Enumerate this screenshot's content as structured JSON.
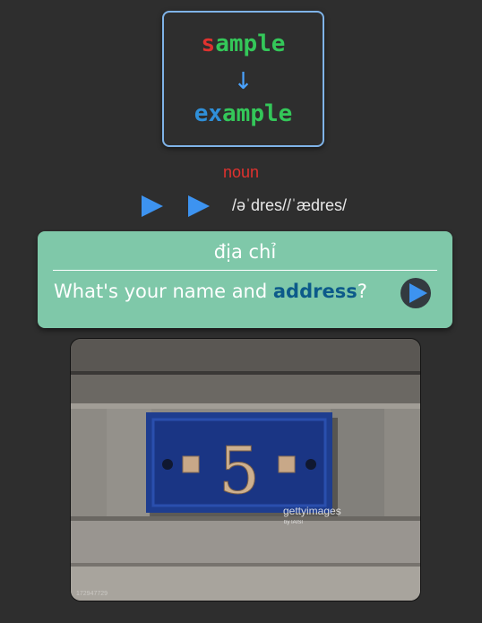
{
  "word_box": {
    "sample_first": "s",
    "sample_rest": "ample",
    "arrow": "↓",
    "example_first": "ex",
    "example_rest": "ample"
  },
  "part_of_speech": "noun",
  "pronunciation": "/əˈdres//ˈædres/",
  "card": {
    "translation": "địa chỉ",
    "sentence_before": "What's your name and ",
    "sentence_highlight": "address",
    "sentence_after": "?"
  },
  "photo": {
    "number": "5",
    "watermark": "gettyimages",
    "watermark_credit": "by IAISI",
    "id_text": "172947729"
  },
  "colors": {
    "background": "#2e2e2e",
    "card": "#7fc8a9",
    "accent_blue": "#3d93f0",
    "red": "#e0322f",
    "green": "#34c759"
  }
}
